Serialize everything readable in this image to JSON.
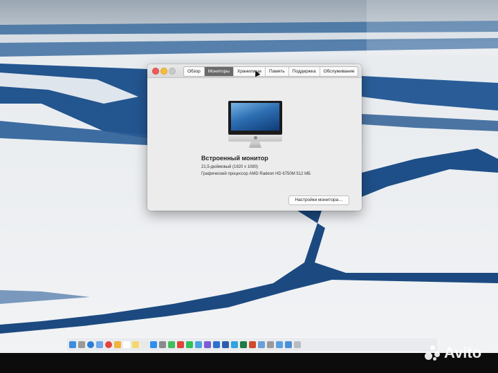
{
  "window": {
    "tabs": [
      {
        "label": "Обзор",
        "active": false
      },
      {
        "label": "Мониторы",
        "active": true
      },
      {
        "label": "Хранилище",
        "active": false
      },
      {
        "label": "Память",
        "active": false
      },
      {
        "label": "Поддержка",
        "active": false
      },
      {
        "label": "Обслуживание",
        "active": false
      }
    ],
    "display_title": "Встроенный монитор",
    "display_size": "21,5-дюймовый (1920 x 1080)",
    "graphics": "Графический процессор AMD Radeon HD 6750M 512 МБ",
    "settings_button": "Настройки монитора…"
  },
  "dock": {
    "icons": [
      "finder-icon",
      "launchpad-icon",
      "safari-icon",
      "mail-icon",
      "chrome-icon",
      "photos-icon",
      "calendar-icon",
      "notes-icon",
      "reminders-icon",
      "app-store-icon",
      "settings-icon",
      "facetime-icon",
      "yandex-icon",
      "whatsapp-icon",
      "phone-icon",
      "viber-icon",
      "mail-app-icon",
      "word-icon",
      "telegram-icon",
      "excel-icon",
      "powerpoint-icon",
      "preview-icon",
      "printer-icon",
      "folder-icon",
      "downloads-icon",
      "trash-icon"
    ]
  },
  "watermark": {
    "text": "Avito"
  },
  "colors": {
    "active_tab": "#6a6a6a",
    "close": "#ee5b54",
    "minimize": "#f5bd3c"
  }
}
